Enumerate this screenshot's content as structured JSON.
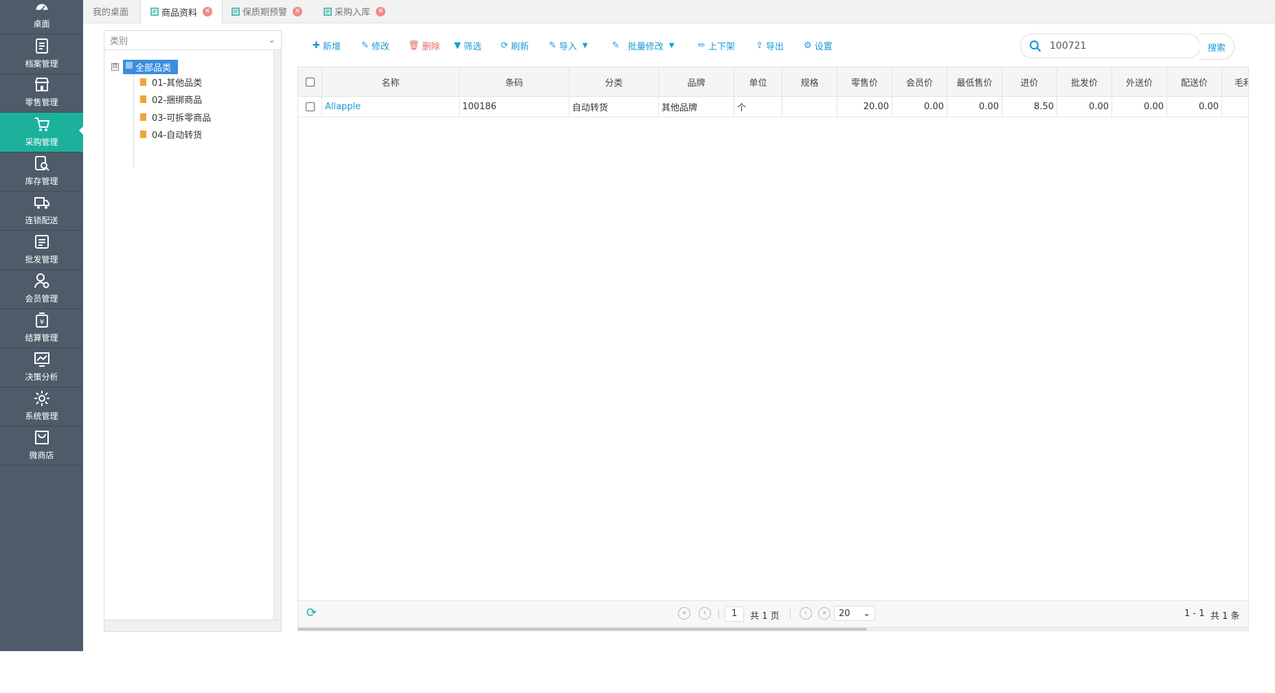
{
  "sidebar": {
    "items": [
      {
        "label": "桌面",
        "icon": "dashboard-icon"
      },
      {
        "label": "档案管理",
        "icon": "archive-icon"
      },
      {
        "label": "零售管理",
        "icon": "store-icon"
      },
      {
        "label": "采购管理",
        "icon": "cart-icon"
      },
      {
        "label": "库存管理",
        "icon": "inventory-icon"
      },
      {
        "label": "连锁配送",
        "icon": "truck-icon"
      },
      {
        "label": "批发管理",
        "icon": "wholesale-icon"
      },
      {
        "label": "会员管理",
        "icon": "member-icon"
      },
      {
        "label": "结算管理",
        "icon": "settlement-icon"
      },
      {
        "label": "决策分析",
        "icon": "chart-icon"
      },
      {
        "label": "系统管理",
        "icon": "gear-icon"
      },
      {
        "label": "微商店",
        "icon": "shop-bag-icon"
      }
    ],
    "active_index": 3
  },
  "tabs": [
    {
      "label": "我的桌面"
    },
    {
      "label": "商品资料"
    },
    {
      "label": "保质期预警"
    },
    {
      "label": "采购入库"
    }
  ],
  "tree": {
    "category_select": "类别",
    "root": "全部品类",
    "toggle": "⊟",
    "children": [
      "01-其他品类",
      "02-捆绑商品",
      "03-可拆零商品",
      "04-自动转货"
    ]
  },
  "toolbar": {
    "add": "新增",
    "edit": "修改",
    "delete": "删除",
    "filter": "筛选",
    "refresh": "刷新",
    "import": "导入",
    "batch_edit": "批量修改",
    "shelf": "上下架",
    "export": "导出",
    "settings": "设置"
  },
  "search": {
    "value": "100721",
    "button": "搜索"
  },
  "grid": {
    "columns": [
      "名称",
      "条码",
      "分类",
      "品牌",
      "单位",
      "规格",
      "零售价",
      "会员价",
      "最低售价",
      "进价",
      "批发价",
      "外送价",
      "配送价",
      "毛利"
    ],
    "rows": [
      {
        "name": "Allapple",
        "barcode": "100186",
        "category": "自动转货",
        "brand": "其他品牌",
        "unit": "个",
        "spec": "",
        "retail": "20.00",
        "member": "0.00",
        "min_price": "0.00",
        "cost": "8.50",
        "wholesale": "0.00",
        "delivery_out": "0.00",
        "distribution": "0.00"
      }
    ]
  },
  "pager": {
    "page": "1",
    "total_pages_text": "共 1 页",
    "page_size": "20",
    "range_text": "1 - 1",
    "total_text": "共 1 条"
  },
  "colors": {
    "sidebar_bg": "#4e5c6a",
    "active": "#1bb19b",
    "accent": "#1a9bd7"
  }
}
